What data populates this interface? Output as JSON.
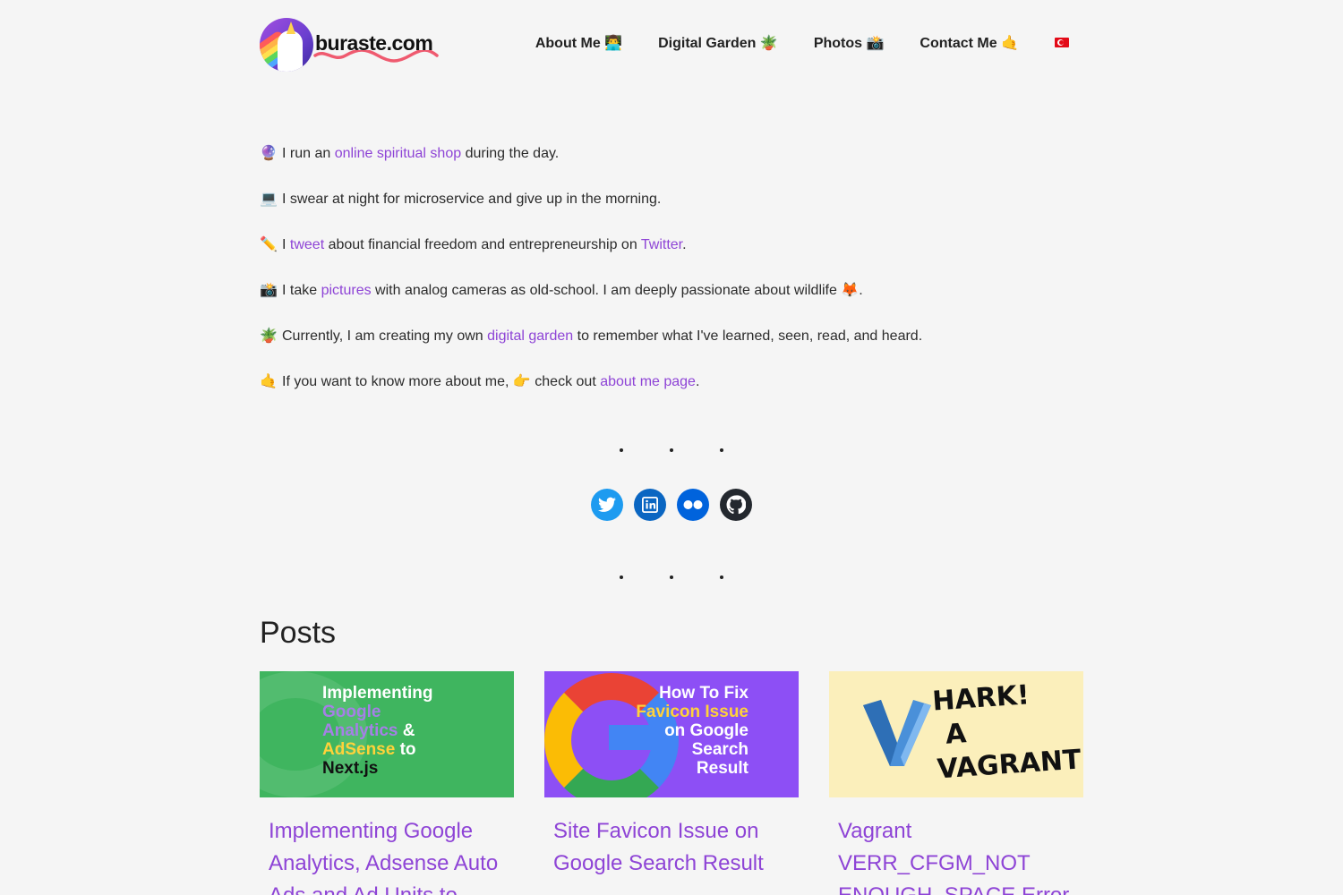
{
  "header": {
    "logo_text": "buraste.com",
    "nav": [
      {
        "label": "About Me 👨‍💻"
      },
      {
        "label": "Digital Garden 🪴"
      },
      {
        "label": "Photos 📸"
      },
      {
        "label": "Contact Me 🤙"
      }
    ],
    "language_flag": "turkish-flag-icon"
  },
  "intro": [
    {
      "emoji": "🔮",
      "before": "I run an ",
      "link": "online spiritual shop",
      "after": " during the day."
    },
    {
      "emoji": "💻",
      "text": "I swear at night for microservice and give up in the morning."
    },
    {
      "emoji": "✏️",
      "before": "I ",
      "link": "tweet",
      "middle": " about financial freedom and entrepreneurship on ",
      "link2": "Twitter",
      "after": "."
    },
    {
      "emoji": "📸",
      "before": "I take ",
      "link": "pictures",
      "after": " with analog cameras as old-school. I am deeply passionate about wildlife 🦊."
    },
    {
      "emoji": "🪴",
      "before": "Currently, I am creating my own ",
      "link": "digital garden",
      "after": " to remember what I've learned, seen, read, and heard."
    },
    {
      "emoji": "🤙",
      "before": "If you want to know more about me, 👉 check out ",
      "link": "about me page",
      "after": "."
    }
  ],
  "socials": [
    {
      "icon": "twitter-icon",
      "color": "#1d9bf0"
    },
    {
      "icon": "linkedin-icon",
      "color": "#0a66c2"
    },
    {
      "icon": "flickr-icon",
      "color": "#0063dc"
    },
    {
      "icon": "github-icon",
      "color": "#24292f"
    }
  ],
  "posts": {
    "title": "Posts",
    "items": [
      {
        "thumb_lines": [
          "Implementing",
          "Google",
          "Analytics",
          "&",
          "AdSense",
          "to",
          "Next.js"
        ],
        "title": "Implementing Google Analytics, Adsense Auto Ads and Ad Units to"
      },
      {
        "thumb_lines": [
          "How To Fix",
          "Favicon Issue",
          "on Google",
          "Search",
          "Result"
        ],
        "title": "Site Favicon Issue on Google Search Result"
      },
      {
        "thumb_lines": [
          "HARK!",
          "A",
          "VAGRANT"
        ],
        "title": "Vagrant VERR_CFGM_NOT ENOUGH_SPACE Error"
      }
    ]
  },
  "colors": {
    "accent": "#8e44d6",
    "background": "#f5f5f5",
    "text": "#2b2b2b"
  }
}
